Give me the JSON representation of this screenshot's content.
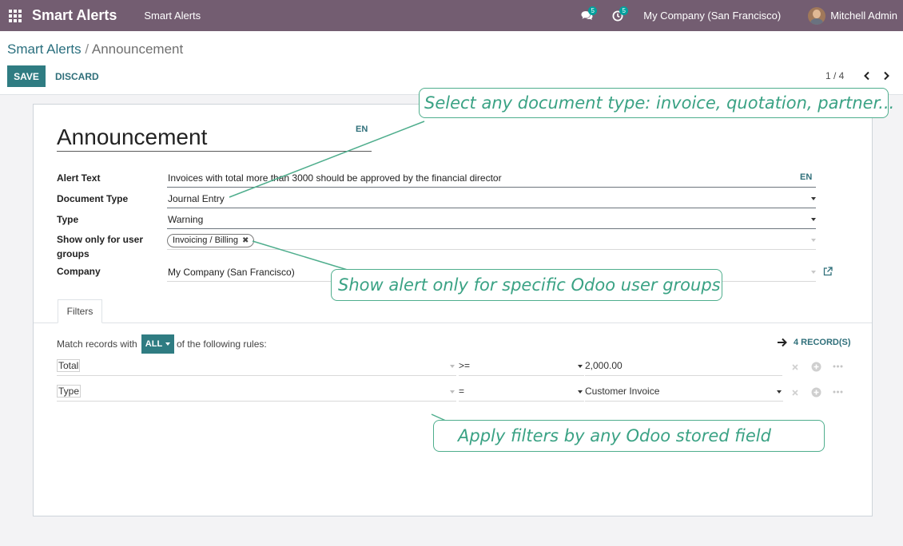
{
  "navbar": {
    "brand": "Smart Alerts",
    "menu_item": "Smart Alerts",
    "messages_count": "5",
    "activities_count": "5",
    "company": "My Company (San Francisco)",
    "user": "Mitchell Admin"
  },
  "breadcrumb": {
    "parent": "Smart Alerts",
    "separator": "/",
    "current": "Announcement"
  },
  "buttons": {
    "save": "SAVE",
    "discard": "DISCARD"
  },
  "pager": {
    "value": "1 / 4"
  },
  "form": {
    "title": "Announcement",
    "title_lang": "EN",
    "fields": {
      "alert_text": {
        "label": "Alert Text",
        "value": "Invoices with total more than 3000 should be approved by the financial director",
        "lang": "EN"
      },
      "document_type": {
        "label": "Document Type",
        "value": "Journal Entry"
      },
      "type": {
        "label": "Type",
        "value": "Warning"
      },
      "user_groups": {
        "label_line1": "Show only for user",
        "label_line2": "groups",
        "tag": "Invoicing / Billing"
      },
      "company": {
        "label": "Company",
        "value": "My Company (San Francisco)"
      }
    }
  },
  "tabs": [
    {
      "label": "Filters",
      "active": true
    }
  ],
  "filters": {
    "match_prefix": "Match records with",
    "match_mode": "ALL",
    "match_suffix": "of the following rules:",
    "records": "4 RECORD(S)",
    "rules": [
      {
        "field": "Total",
        "operator": ">=",
        "value": "2,000.00"
      },
      {
        "field": "Type",
        "operator": "=",
        "value": "Customer Invoice"
      }
    ]
  },
  "callouts": {
    "document_type": "Select any document type: invoice, quotation, partner...",
    "user_groups": "Show alert only for specific Odoo user groups",
    "filters": "Apply filters by any Odoo stored field"
  },
  "colors": {
    "navbar": "#735d71",
    "primary": "#2f7c82",
    "callout": "#4fae8d"
  },
  "icons": {
    "apps": "apps-grid-icon",
    "messages": "chat-icon",
    "activities": "clock-icon",
    "pager_prev": "chevron-left-icon",
    "pager_next": "chevron-right-icon",
    "external": "external-link-icon",
    "records": "arrow-right-icon",
    "rule_delete": "close-icon",
    "rule_add": "plus-circle-icon",
    "rule_more": "ellipsis-icon"
  }
}
